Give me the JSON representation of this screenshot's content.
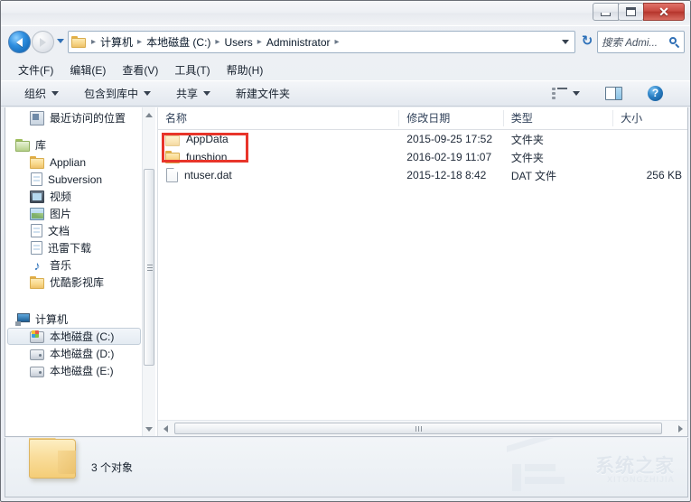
{
  "window": {
    "controls": {
      "minimize": "minimize-button",
      "maximize": "maximize-button",
      "close": "✕"
    }
  },
  "nav": {
    "back_title": "后退",
    "forward_title": "前进",
    "breadcrumbs": [
      "计算机",
      "本地磁盘 (C:)",
      "Users",
      "Administrator"
    ],
    "separator": "▸",
    "refresh": "↻"
  },
  "search": {
    "placeholder": "搜索 Admi...",
    "value": "搜索 Admi..."
  },
  "menubar": {
    "items": [
      {
        "text": "文件(F)"
      },
      {
        "text": "编辑(E)"
      },
      {
        "text": "查看(V)"
      },
      {
        "text": "工具(T)"
      },
      {
        "text": "帮助(H)"
      }
    ]
  },
  "toolbar": {
    "organize": "组织",
    "include_in_library": "包含到库中",
    "share": "共享",
    "new_folder": "新建文件夹",
    "help_glyph": "?"
  },
  "sidebar": {
    "items": [
      {
        "label": "最近访问的位置",
        "icon": "recent-places-icon",
        "indent": 1,
        "selected": false
      },
      {
        "label": "库",
        "icon": "library-icon",
        "indent": 0,
        "selected": false
      },
      {
        "label": "Applian",
        "icon": "folder-icon",
        "indent": 1,
        "selected": false
      },
      {
        "label": "Subversion",
        "icon": "document-icon",
        "indent": 1,
        "selected": false
      },
      {
        "label": "视频",
        "icon": "video-icon",
        "indent": 1,
        "selected": false
      },
      {
        "label": "图片",
        "icon": "picture-icon",
        "indent": 1,
        "selected": false
      },
      {
        "label": "文档",
        "icon": "document-icon",
        "indent": 1,
        "selected": false
      },
      {
        "label": "迅雷下载",
        "icon": "document-icon",
        "indent": 1,
        "selected": false
      },
      {
        "label": "音乐",
        "icon": "music-icon",
        "indent": 1,
        "selected": false
      },
      {
        "label": "优酷影视库",
        "icon": "folder-icon",
        "indent": 1,
        "selected": false
      },
      {
        "label": "计算机",
        "icon": "computer-icon",
        "indent": 0,
        "selected": false
      },
      {
        "label": "本地磁盘 (C:)",
        "icon": "drive-windows-icon",
        "indent": 1,
        "selected": true
      },
      {
        "label": "本地磁盘 (D:)",
        "icon": "drive-icon",
        "indent": 1,
        "selected": false
      },
      {
        "label": "本地磁盘 (E:)",
        "icon": "drive-icon",
        "indent": 1,
        "selected": false
      }
    ]
  },
  "filelist": {
    "columns": [
      {
        "label": "名称",
        "key": "name"
      },
      {
        "label": "修改日期",
        "key": "date"
      },
      {
        "label": "类型",
        "key": "type"
      },
      {
        "label": "大小",
        "key": "size"
      }
    ],
    "rows": [
      {
        "name": "AppData",
        "date": "2015-09-25 17:52",
        "type": "文件夹",
        "size": "",
        "icon": "folder-hidden-icon",
        "highlighted": true
      },
      {
        "name": "funshion",
        "date": "2016-02-19 11:07",
        "type": "文件夹",
        "size": "",
        "icon": "folder-icon",
        "highlighted": false
      },
      {
        "name": "ntuser.dat",
        "date": "2015-12-18 8:42",
        "type": "DAT 文件",
        "size": "256 KB",
        "icon": "file-icon",
        "highlighted": false
      }
    ],
    "annotation_color": "#e8352a"
  },
  "statusbar": {
    "count_text": "3 个对象"
  },
  "watermark": {
    "title": "系统之家",
    "subtitle": "XITONGZHIJIA"
  }
}
